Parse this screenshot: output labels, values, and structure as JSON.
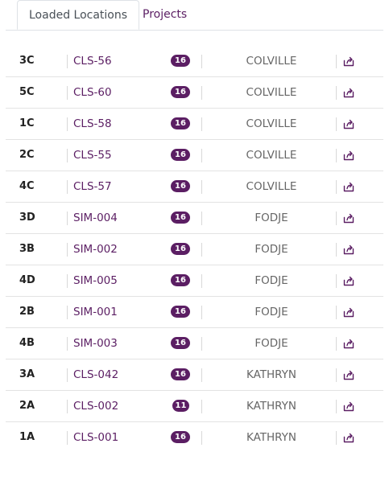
{
  "tabs": [
    {
      "label": "Loaded Locations",
      "active": true
    },
    {
      "label": "Projects",
      "active": false
    }
  ],
  "rows": [
    {
      "location": "3C",
      "code": "CLS-56",
      "count": "16",
      "project": "COLVILLE"
    },
    {
      "location": "5C",
      "code": "CLS-60",
      "count": "16",
      "project": "COLVILLE"
    },
    {
      "location": "1C",
      "code": "CLS-58",
      "count": "16",
      "project": "COLVILLE"
    },
    {
      "location": "2C",
      "code": "CLS-55",
      "count": "16",
      "project": "COLVILLE"
    },
    {
      "location": "4C",
      "code": "CLS-57",
      "count": "16",
      "project": "COLVILLE"
    },
    {
      "location": "3D",
      "code": "SIM-004",
      "count": "16",
      "project": "FODJE"
    },
    {
      "location": "3B",
      "code": "SIM-002",
      "count": "16",
      "project": "FODJE"
    },
    {
      "location": "4D",
      "code": "SIM-005",
      "count": "16",
      "project": "FODJE"
    },
    {
      "location": "2B",
      "code": "SIM-001",
      "count": "16",
      "project": "FODJE"
    },
    {
      "location": "4B",
      "code": "SIM-003",
      "count": "16",
      "project": "FODJE"
    },
    {
      "location": "3A",
      "code": "CLS-042",
      "count": "16",
      "project": "KATHRYN"
    },
    {
      "location": "2A",
      "code": "CLS-002",
      "count": "11",
      "project": "KATHRYN"
    },
    {
      "location": "1A",
      "code": "CLS-001",
      "count": "16",
      "project": "KATHRYN"
    }
  ],
  "colors": {
    "accent": "#5b1e63",
    "divider": "#e3e3e3"
  },
  "icons": {
    "row_action": "share-export-icon"
  }
}
